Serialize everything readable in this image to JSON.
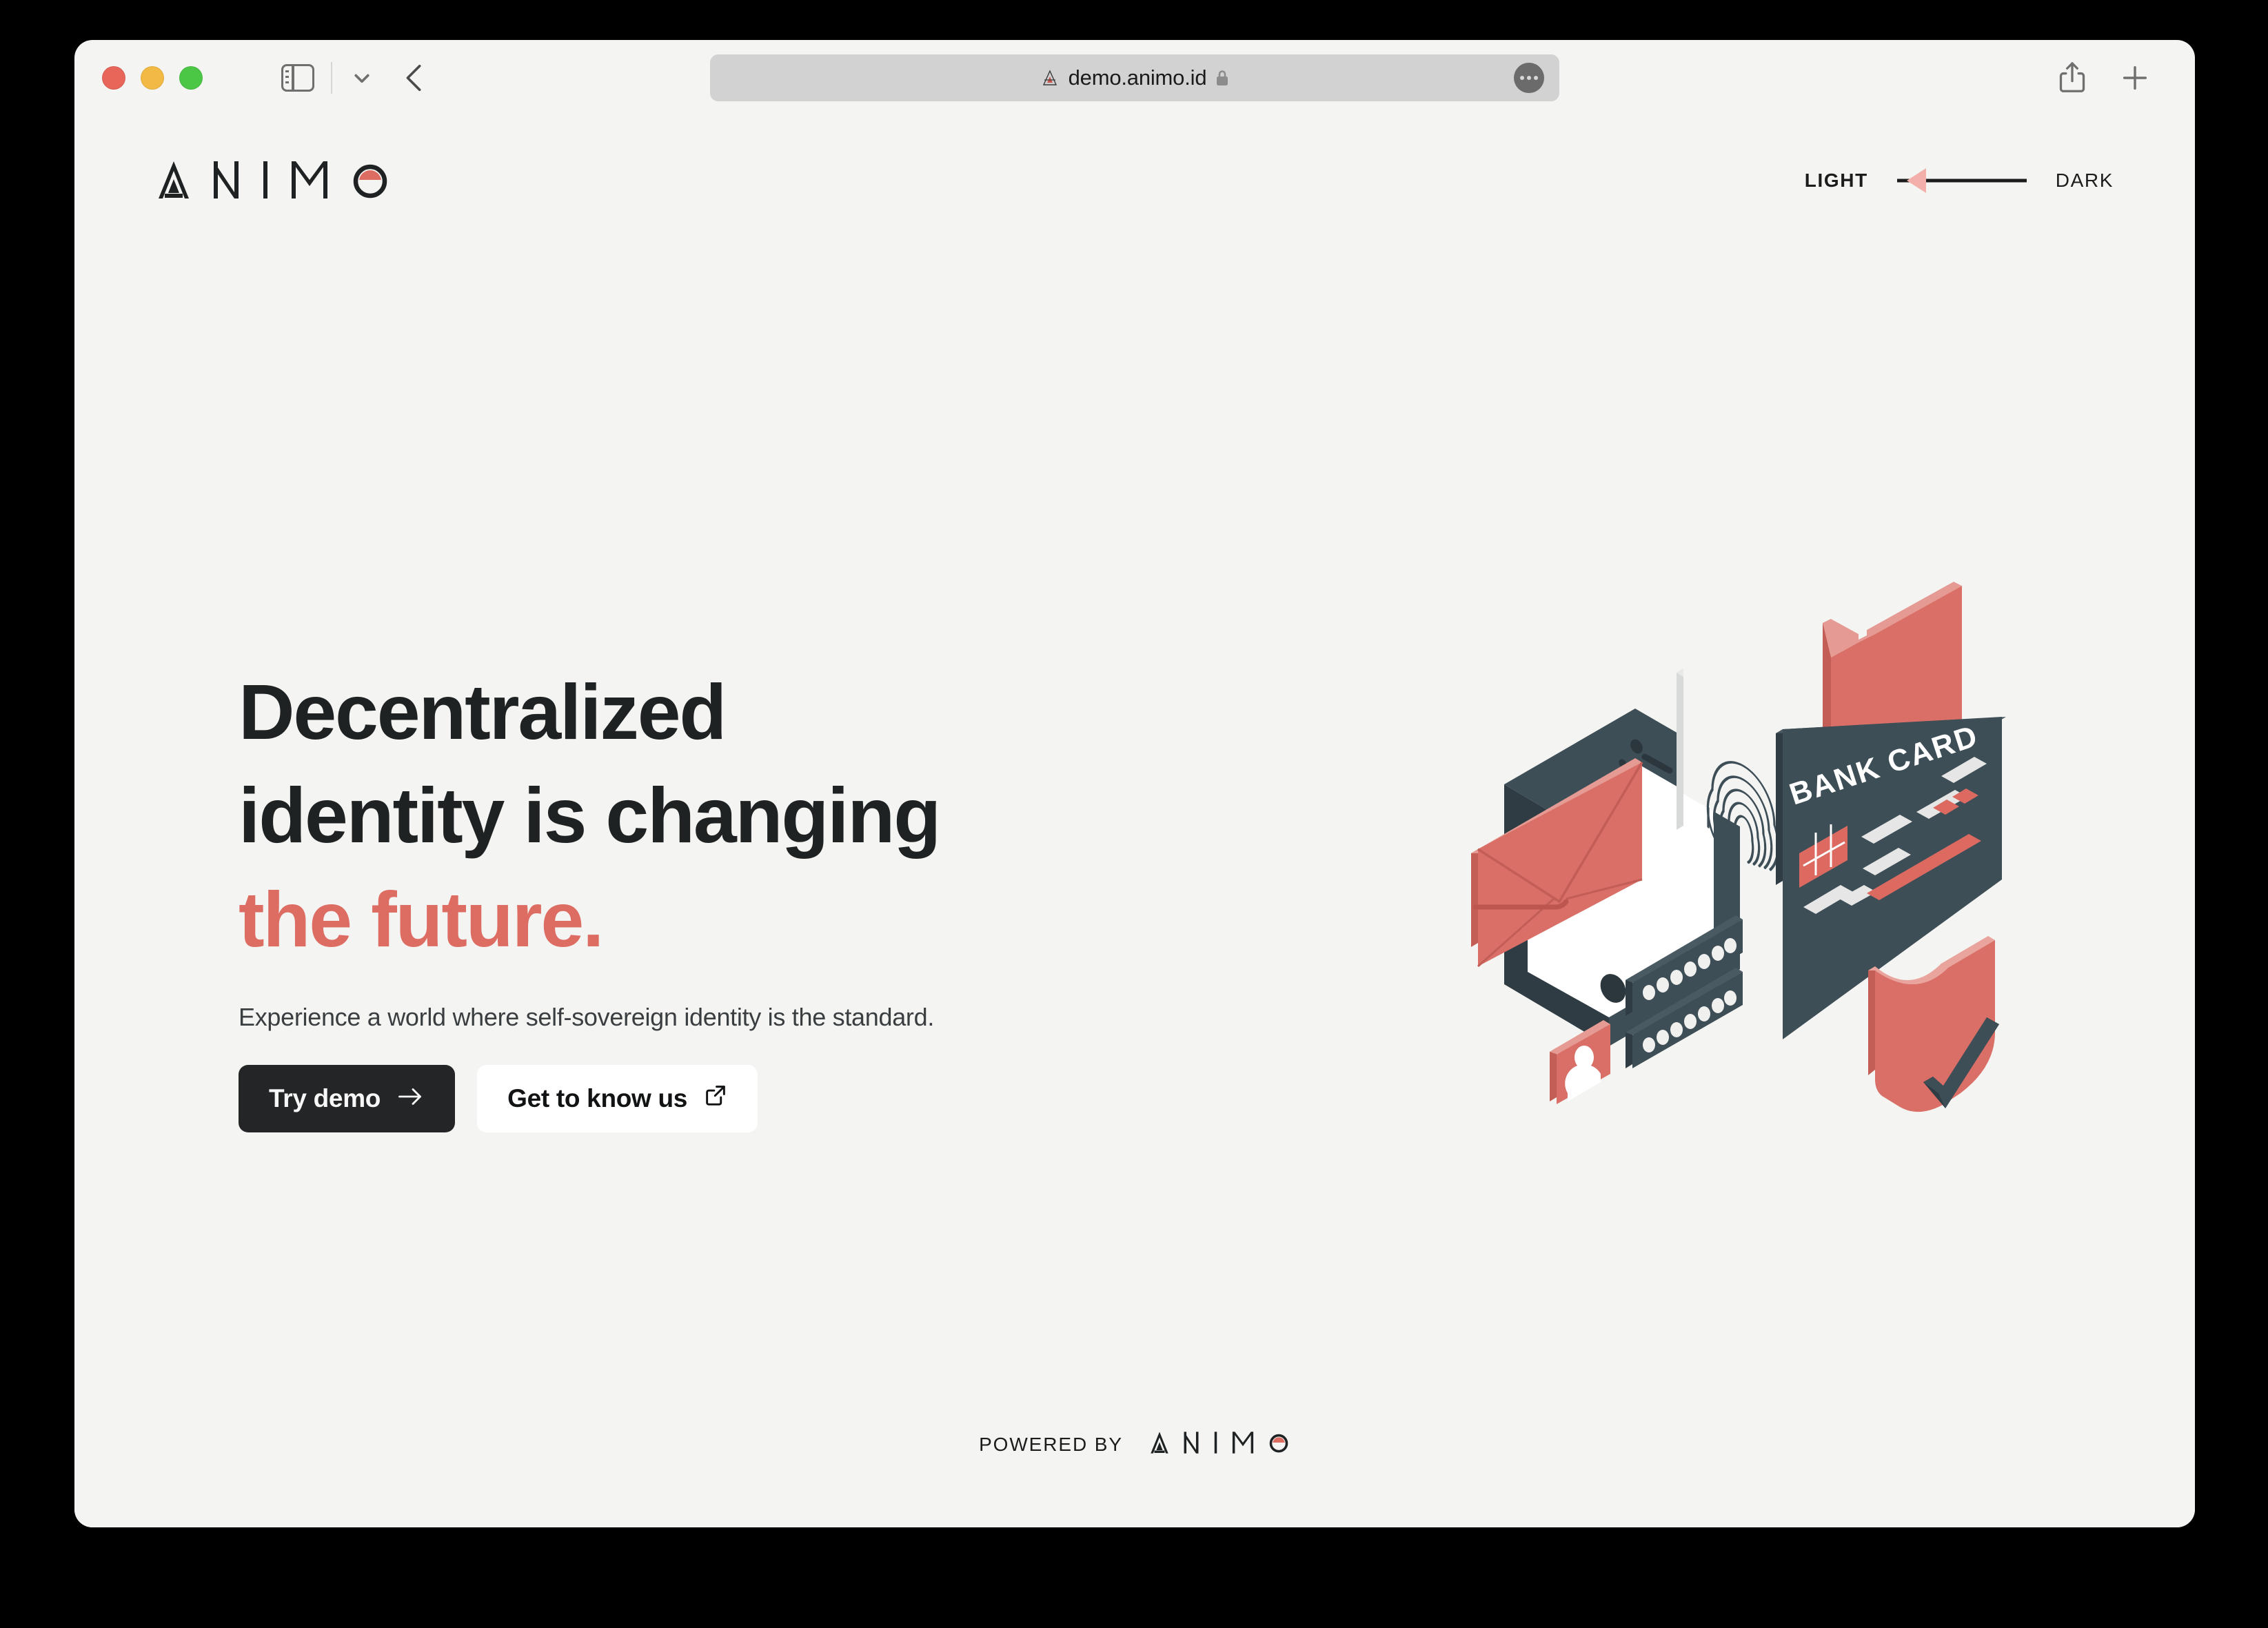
{
  "browser": {
    "traffic_lights": [
      "close",
      "minimize",
      "maximize"
    ],
    "sidebar_toggle_icon": "sidebar-icon",
    "sidebar_chevron_icon": "chevron-down-icon",
    "back_icon": "chevron-left-icon",
    "url": "demo.animo.id",
    "favicon_icon": "animo-favicon-icon",
    "lock_icon": "lock-icon",
    "more_icon": "ellipsis-icon",
    "share_icon": "share-icon",
    "new_tab_icon": "plus-icon"
  },
  "header": {
    "brand": "ANIMO",
    "brand_letters": [
      "A",
      "N",
      "I",
      "M",
      "O"
    ],
    "theme_toggle": {
      "light_label": "LIGHT",
      "dark_label": "DARK",
      "active": "LIGHT",
      "knob_icon": "triangle-left-icon"
    }
  },
  "hero": {
    "headline_line1": "Decentralized",
    "headline_line2": "identity is changing",
    "headline_accent": "the future.",
    "subtitle": "Experience a world where self-sovereign identity is the standard.",
    "primary_button": {
      "label": "Try demo",
      "icon": "arrow-right-icon"
    },
    "secondary_button": {
      "label": "Get to know us",
      "icon": "external-link-icon"
    },
    "illustration": {
      "name": "decentralized-identity-isometric-illustration",
      "elements": [
        "tablet-device",
        "fingerprint-card",
        "red-folder",
        "red-envelope",
        "bank-card",
        "password-field-bar",
        "password-field-bar",
        "avatar-id-card",
        "security-shield",
        "checkmark"
      ],
      "bank_card_label": "BANK CARD"
    }
  },
  "footer": {
    "powered_by_label": "POWERED BY",
    "brand": "ANIMO",
    "brand_letters": [
      "A",
      "N",
      "I",
      "M",
      "O"
    ]
  },
  "colors": {
    "page_background": "#F4F4F2",
    "text_primary": "#1F2223",
    "accent_coral": "#DD6C63",
    "accent_coral_light": "#E8A099",
    "dark_slate": "#3E4E57",
    "button_dark": "#232526",
    "desktop_backdrop": "#000000"
  }
}
